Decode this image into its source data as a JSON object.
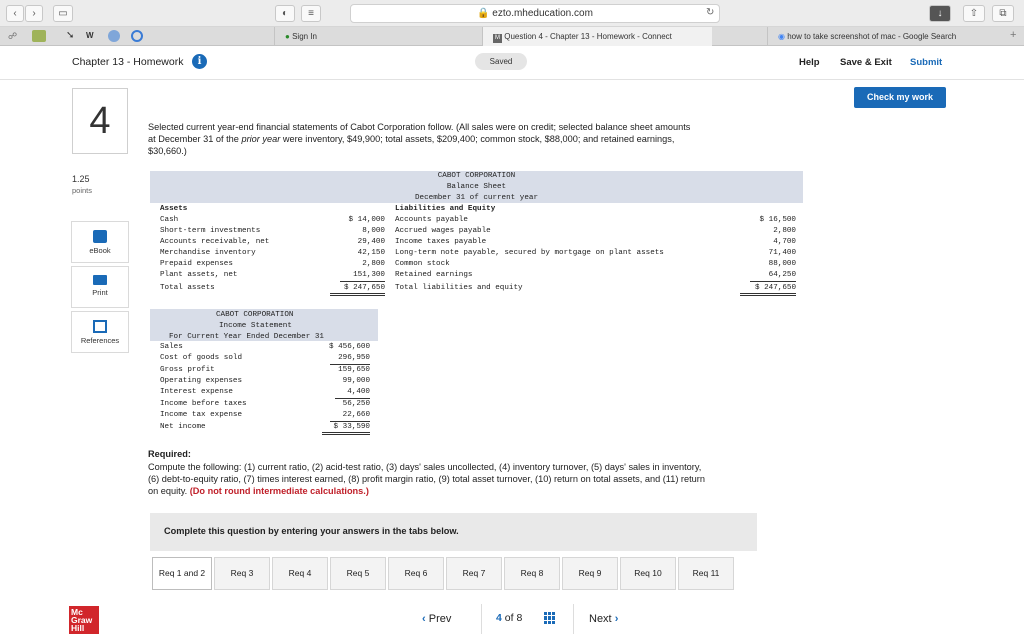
{
  "browser": {
    "url": "ezto.mheducation.com",
    "tabs": [
      {
        "label": "Sign In"
      },
      {
        "label": "Question 4 - Chapter 13 - Homework - Connect"
      },
      {
        "label": "how to take screenshot of mac - Google Search"
      }
    ]
  },
  "header": {
    "title": "Chapter 13 - Homework",
    "saved": "Saved",
    "help": "Help",
    "save_exit": "Save & Exit",
    "submit": "Submit",
    "check": "Check my work"
  },
  "question": {
    "number": "4",
    "points_value": "1.25",
    "points_label": "points",
    "prompt_line1": "Selected current year-end financial statements of Cabot Corporation follow. (All sales were on credit; selected balance sheet amounts",
    "prompt_line2a": "at December 31 of the ",
    "prompt_line2b": "prior year",
    "prompt_line2c": " were inventory, $49,900; total assets, $209,400; common stock, $88,000; and retained earnings,",
    "prompt_line3": "$30,660.)"
  },
  "rail": {
    "ebook": "eBook",
    "print": "Print",
    "references": "References"
  },
  "balance_sheet": {
    "company": "CABOT CORPORATION",
    "title": "Balance Sheet",
    "date": "December 31 of current year",
    "assets_heading": "Assets",
    "liab_heading": "Liabilities and Equity",
    "assets": [
      {
        "label": "Cash",
        "value": "$ 14,000"
      },
      {
        "label": "Short-term investments",
        "value": "8,000"
      },
      {
        "label": "Accounts receivable, net",
        "value": "29,400"
      },
      {
        "label": "Merchandise inventory",
        "value": "42,150"
      },
      {
        "label": "Prepaid expenses",
        "value": "2,800"
      },
      {
        "label": "Plant assets, net",
        "value": "151,300"
      }
    ],
    "total_assets_label": "Total assets",
    "total_assets": "$ 247,650",
    "liabilities": [
      {
        "label": "Accounts payable",
        "value": "$ 16,500"
      },
      {
        "label": "Accrued wages payable",
        "value": "2,800"
      },
      {
        "label": "Income taxes payable",
        "value": "4,700"
      },
      {
        "label": "Long-term note payable, secured by mortgage on plant assets",
        "value": "71,400"
      },
      {
        "label": "Common stock",
        "value": "88,000"
      },
      {
        "label": "Retained earnings",
        "value": "64,250"
      }
    ],
    "total_liab_label": "Total liabilities and equity",
    "total_liab": "$ 247,650"
  },
  "income_statement": {
    "company": "CABOT CORPORATION",
    "title": "Income Statement",
    "period": "For Current Year Ended December 31",
    "rows": [
      {
        "label": "Sales",
        "value": "$ 456,600"
      },
      {
        "label": "Cost of goods sold",
        "value": "296,950"
      },
      {
        "label": "Gross profit",
        "value": "159,650"
      },
      {
        "label": "Operating expenses",
        "value": "99,000"
      },
      {
        "label": "Interest expense",
        "value": "4,400"
      },
      {
        "label": "Income before taxes",
        "value": "56,250"
      },
      {
        "label": "Income tax expense",
        "value": "22,660"
      }
    ],
    "net_label": "Net income",
    "net_value": "$ 33,590"
  },
  "required": {
    "heading": "Required:",
    "line1": "Compute the following: (1) current ratio, (2) acid-test ratio, (3) days' sales uncollected, (4) inventory turnover, (5) days' sales in inventory,",
    "line2": "(6) debt-to-equity ratio, (7) times interest earned, (8) profit margin ratio, (9) total asset turnover, (10) return on total assets, and (11) return",
    "line3a": "on equity. ",
    "line3b": "(Do not round intermediate calculations.)"
  },
  "complete_text": "Complete this question by entering your answers in the tabs below.",
  "req_tabs": [
    "Req 1 and 2",
    "Req 3",
    "Req 4",
    "Req 5",
    "Req 6",
    "Req 7",
    "Req 8",
    "Req 9",
    "Req 10",
    "Req 11"
  ],
  "footer": {
    "logo": [
      "Mc",
      "Graw",
      "Hill"
    ],
    "prev": "Prev",
    "page_current": "4",
    "page_of": "of 8",
    "next": "Next"
  }
}
